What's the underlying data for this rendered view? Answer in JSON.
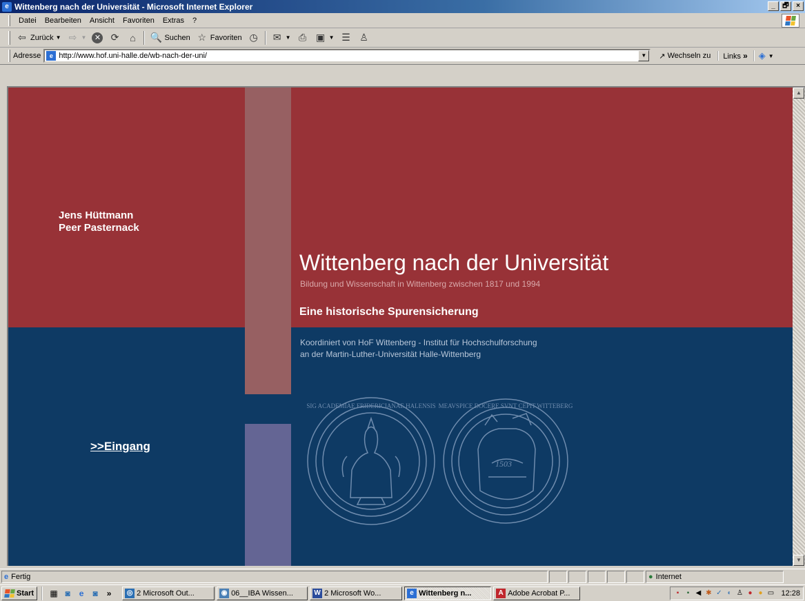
{
  "window": {
    "title": "Wittenberg nach der Universität - Microsoft Internet Explorer",
    "controls": [
      "_",
      "🗗",
      "×"
    ]
  },
  "menu": [
    "Datei",
    "Bearbeiten",
    "Ansicht",
    "Favoriten",
    "Extras",
    "?"
  ],
  "toolbar": {
    "back_label": "Zurück",
    "search_label": "Suchen",
    "favorites_label": "Favoriten"
  },
  "address": {
    "label": "Adresse",
    "url": "http://www.hof.uni-halle.de/wb-nach-der-uni/",
    "go_label": "Wechseln zu",
    "links_label": "Links"
  },
  "page": {
    "authors": [
      "Jens Hüttmann",
      "Peer Pasternack"
    ],
    "title": "Wittenberg nach der Universität",
    "subtitle": "Bildung und Wissenschaft in Wittenberg zwischen 1817 und 1994",
    "tagline": "Eine historische Spurensicherung",
    "coordination": [
      "Koordiniert von HoF Wittenberg - Institut für Hochschulforschung",
      "an der Martin-Luther-Universität Halle-Wittenberg"
    ],
    "enter_link": ">>Eingang",
    "seal_left_text": "SIG ACADEMIAE FRIDERICIANAE HALENSIS",
    "seal_right_text": "MEAVSPICE DOCERE SVNT CEPIT WITTEBERG",
    "seal_year": "1503"
  },
  "statusbar": {
    "status": "Fertig",
    "zone": "Internet"
  },
  "taskbar": {
    "start_label": "Start",
    "tasks": [
      {
        "label": "2 Microsoft Out...",
        "icon": "outlook-icon",
        "color": "#2b6fb3"
      },
      {
        "label": "06__IBA Wissen...",
        "icon": "folder-search-icon",
        "color": "#4a7fb5"
      },
      {
        "label": "2 Microsoft Wo...",
        "icon": "word-icon",
        "color": "#2b4c9c"
      },
      {
        "label": "Wittenberg n...",
        "icon": "ie-icon",
        "color": "#2c6fd4",
        "active": true
      },
      {
        "label": "Adobe Acrobat P...",
        "icon": "acrobat-icon",
        "color": "#c0272d"
      }
    ],
    "more": "»",
    "clock": "12:28"
  }
}
